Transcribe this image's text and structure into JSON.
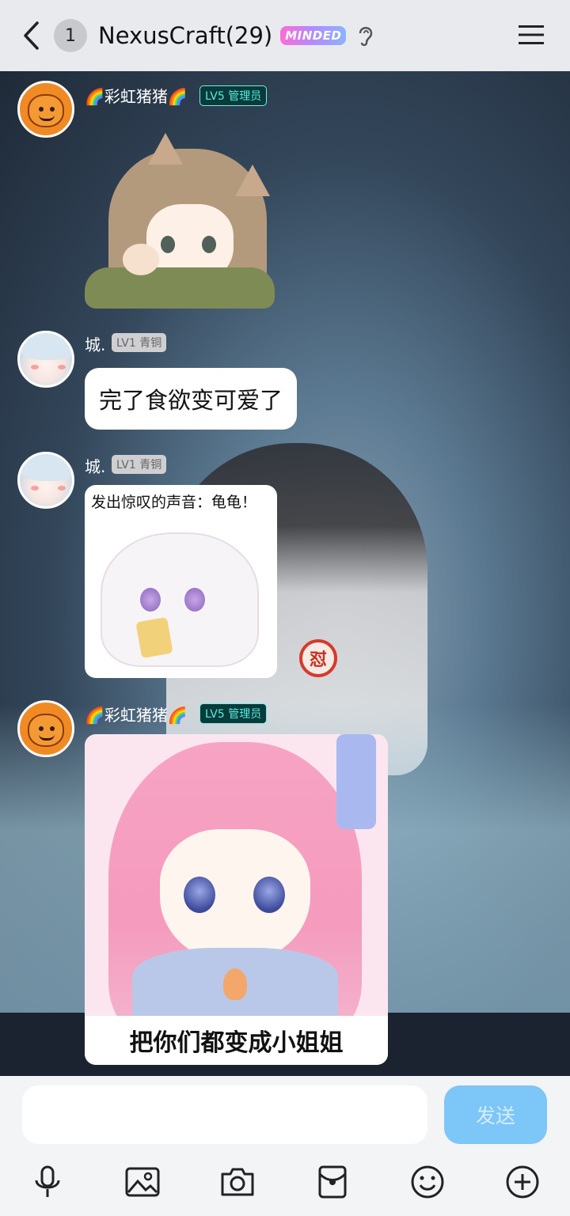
{
  "header": {
    "back_icon": "chevron-left-icon",
    "unread_count": "1",
    "title": "NexusCraft(29)",
    "badge": "MINDED",
    "ear_icon": "ear-icon",
    "menu_icon": "hamburger-menu-icon"
  },
  "messages": [
    {
      "sender": "🌈彩虹猪猪🌈",
      "level": "LV5 管理员",
      "avatar": "orange-pig-avatar",
      "type": "sticker",
      "sticker": "cat-eared-girl-pointing"
    },
    {
      "sender": "城.",
      "level": "LV1 青铜",
      "avatar": "white-hair-girl-avatar",
      "type": "text",
      "text": "完了食欲变可爱了"
    },
    {
      "sender": "城.",
      "level": "LV1 青铜",
      "avatar": "white-hair-girl-avatar",
      "type": "sticker",
      "caption": "发出惊叹的声音：龟龟！"
    },
    {
      "sender": "🌈彩虹猪猪🌈",
      "level": "LV5 管理员",
      "avatar": "orange-pig-avatar",
      "type": "sticker",
      "caption": "把你们都变成小姐姐"
    }
  ],
  "background": {
    "stamp_icon": "怼"
  },
  "composer": {
    "input_value": "",
    "send_label": "发送",
    "tools": [
      "microphone-icon",
      "image-icon",
      "camera-icon",
      "red-packet-icon",
      "emoji-icon",
      "plus-icon"
    ]
  },
  "colors": {
    "header_bg": "#e9eaee",
    "send_button": "#7cc6f8",
    "admin_tag": "#4ff0e0"
  }
}
